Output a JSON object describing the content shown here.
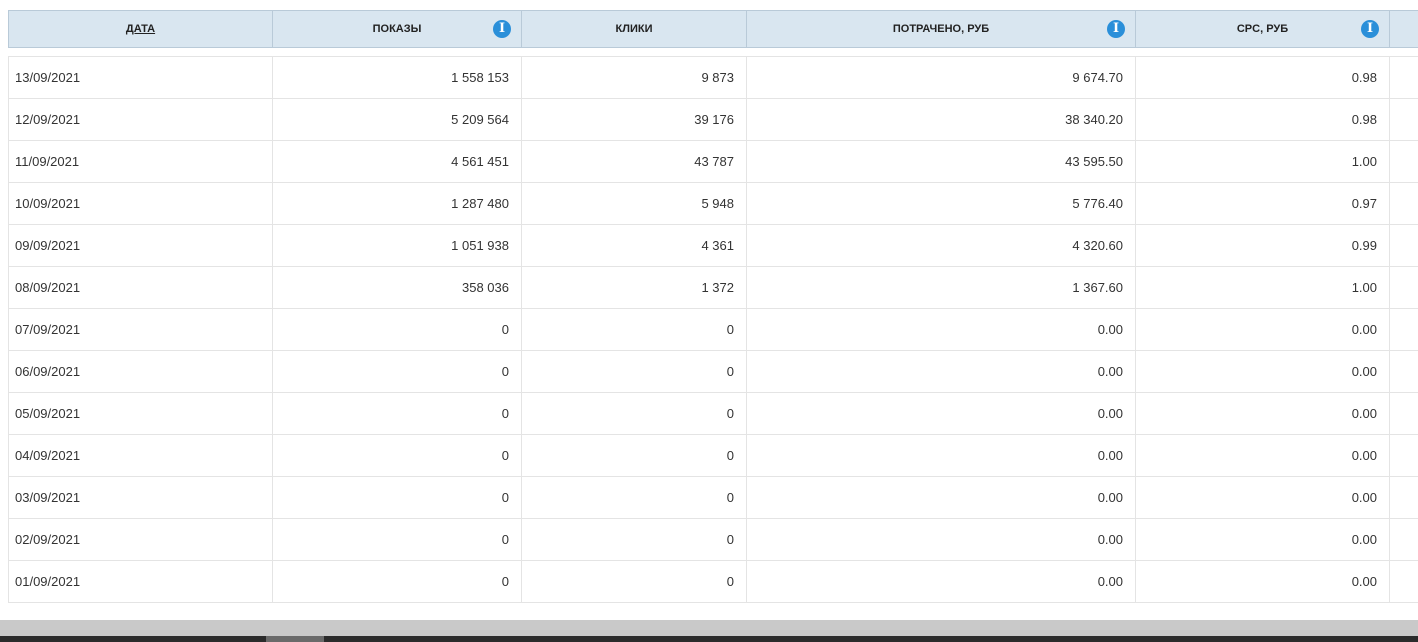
{
  "table": {
    "headers": {
      "date": "ДАТА",
      "impressions": "ПОКАЗЫ",
      "clicks": "КЛИКИ",
      "spent": "ПОТРАЧЕНО, РУБ",
      "cpc": "CPC, РУБ"
    },
    "info_icon_glyph": "i",
    "rows": [
      {
        "date": "13/09/2021",
        "impressions": "1 558 153",
        "clicks": "9 873",
        "spent": "9 674.70",
        "cpc": "0.98"
      },
      {
        "date": "12/09/2021",
        "impressions": "5 209 564",
        "clicks": "39 176",
        "spent": "38 340.20",
        "cpc": "0.98"
      },
      {
        "date": "11/09/2021",
        "impressions": "4 561 451",
        "clicks": "43 787",
        "spent": "43 595.50",
        "cpc": "1.00"
      },
      {
        "date": "10/09/2021",
        "impressions": "1 287 480",
        "clicks": "5 948",
        "spent": "5 776.40",
        "cpc": "0.97"
      },
      {
        "date": "09/09/2021",
        "impressions": "1 051 938",
        "clicks": "4 361",
        "spent": "4 320.60",
        "cpc": "0.99"
      },
      {
        "date": "08/09/2021",
        "impressions": "358 036",
        "clicks": "1 372",
        "spent": "1 367.60",
        "cpc": "1.00"
      },
      {
        "date": "07/09/2021",
        "impressions": "0",
        "clicks": "0",
        "spent": "0.00",
        "cpc": "0.00"
      },
      {
        "date": "06/09/2021",
        "impressions": "0",
        "clicks": "0",
        "spent": "0.00",
        "cpc": "0.00"
      },
      {
        "date": "05/09/2021",
        "impressions": "0",
        "clicks": "0",
        "spent": "0.00",
        "cpc": "0.00"
      },
      {
        "date": "04/09/2021",
        "impressions": "0",
        "clicks": "0",
        "spent": "0.00",
        "cpc": "0.00"
      },
      {
        "date": "03/09/2021",
        "impressions": "0",
        "clicks": "0",
        "spent": "0.00",
        "cpc": "0.00"
      },
      {
        "date": "02/09/2021",
        "impressions": "0",
        "clicks": "0",
        "spent": "0.00",
        "cpc": "0.00"
      },
      {
        "date": "01/09/2021",
        "impressions": "0",
        "clicks": "0",
        "spent": "0.00",
        "cpc": "0.00"
      }
    ]
  },
  "colors": {
    "header_bg": "#d9e6f0",
    "info_icon": "#2a8fd9",
    "row_border": "#e4e4e4"
  }
}
